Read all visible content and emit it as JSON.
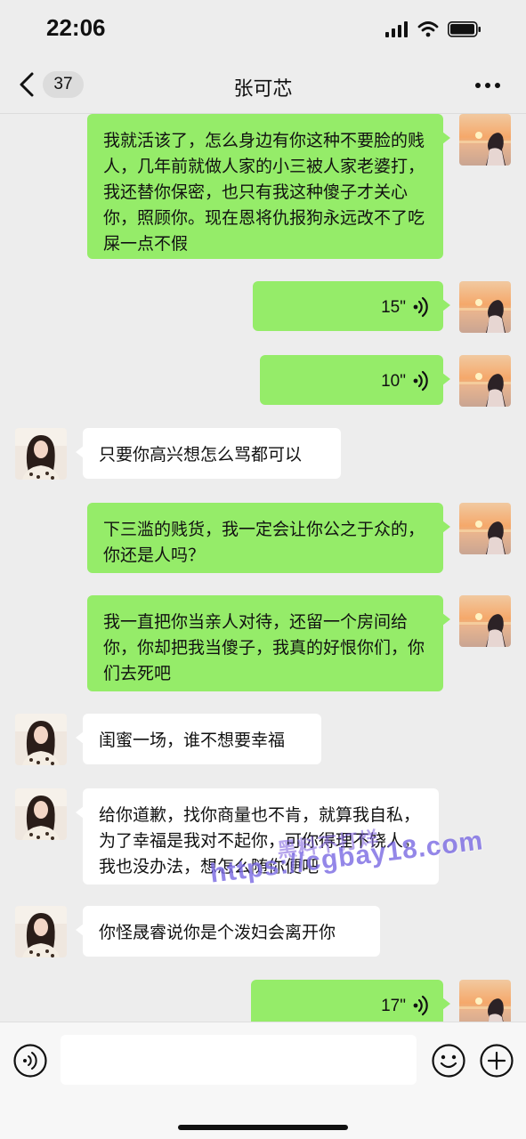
{
  "status_bar": {
    "time": "22:06"
  },
  "nav": {
    "unread_count": "37",
    "title": "张可芯"
  },
  "messages": [
    {
      "side": "sent",
      "type": "text",
      "text": "我就活该了，怎么身边有你这种不要脸的贱人，几年前就做人家的小三被人家老婆打，我还替你保密，也只有我这种傻子才关心你，照顾你。现在恩将仇报狗永远改不了吃屎一点不假"
    },
    {
      "side": "sent",
      "type": "voice",
      "duration": "15\""
    },
    {
      "side": "sent",
      "type": "voice",
      "duration": "10\""
    },
    {
      "side": "recv",
      "type": "text",
      "text": "只要你高兴想怎么骂都可以"
    },
    {
      "side": "sent",
      "type": "text",
      "text": "下三滥的贱货，我一定会让你公之于众的，你还是人吗？"
    },
    {
      "side": "sent",
      "type": "text",
      "text": "我一直把你当亲人对待，还留一个房间给你，你却把我当傻子，我真的好恨你们，你们去死吧"
    },
    {
      "side": "recv",
      "type": "text",
      "text": "闺蜜一场，谁不想要幸福"
    },
    {
      "side": "recv",
      "type": "text",
      "text": "给你道歉，找你商量也不肯，就算我自私，为了幸福是我对不起你，可你得理不饶人，我也没办法，想怎么随你便吧"
    },
    {
      "side": "recv",
      "type": "text",
      "text": "你怪晟睿说你是个泼妇会离开你"
    },
    {
      "side": "sent",
      "type": "voice",
      "duration": "17\""
    }
  ],
  "watermark": {
    "line1": "黑料不打烊",
    "line2": "https://cgbay18.com"
  },
  "input": {
    "placeholder": ""
  },
  "icons": {
    "back": "chevron-left-icon",
    "more": "more-dots-icon",
    "voice_message": "sound-wave-icon",
    "voice_toggle": "voice-input-icon",
    "emoji": "emoji-smile-icon",
    "plus": "plus-circle-icon"
  },
  "colors": {
    "sent_bubble": "#95ec69",
    "recv_bubble": "#ffffff",
    "background": "#ededed"
  }
}
